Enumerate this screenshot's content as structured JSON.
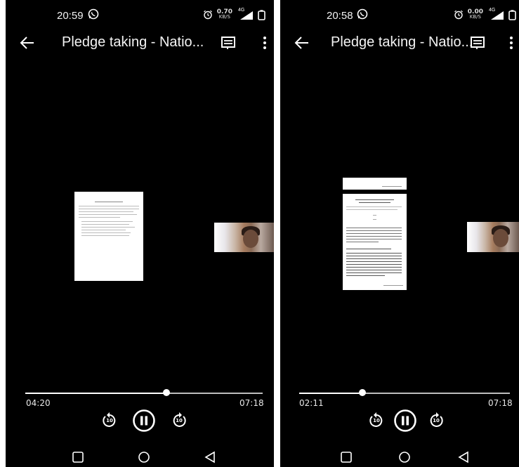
{
  "screens": [
    {
      "status": {
        "time": "20:59",
        "net_value": "0.70",
        "net_unit": "KB/S",
        "net_type": "4G"
      },
      "title": "Pledge taking - Natio...",
      "playback": {
        "elapsed": "04:20",
        "duration": "07:18",
        "progress_fraction": 0.594
      },
      "controls": {
        "rewind_label": "10",
        "forward_label": "10"
      }
    },
    {
      "status": {
        "time": "20:58",
        "net_value": "0.00",
        "net_unit": "KB/S",
        "net_type": "4G"
      },
      "title": "Pledge taking - Natio...",
      "playback": {
        "elapsed": "02:11",
        "duration": "07:18",
        "progress_fraction": 0.299
      },
      "controls": {
        "rewind_label": "10",
        "forward_label": "10"
      }
    }
  ],
  "icons": {
    "status_left": "whatsapp-icon",
    "status_right": [
      "alarm-icon",
      "signal-icon",
      "battery-icon"
    ],
    "appbar": [
      "back-arrow-icon",
      "subtitles-icon",
      "more-vert-icon"
    ],
    "player": [
      "rewind-10-icon",
      "pause-icon",
      "forward-10-icon"
    ],
    "navbar": [
      "recents-square-icon",
      "home-circle-icon",
      "back-triangle-icon"
    ]
  },
  "colors": {
    "background": "#000000",
    "foreground": "#ffffff",
    "seek_track": "#bdbdbd"
  }
}
